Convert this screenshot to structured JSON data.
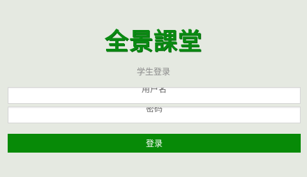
{
  "brand": {
    "logo_text": "全景課堂"
  },
  "form": {
    "subtitle": "学生登录",
    "username_placeholder": "用户名",
    "password_placeholder": "密码",
    "submit_label": "登录"
  },
  "colors": {
    "background": "#e5e9e1",
    "brand_green": "#0a8a12",
    "button_green": "#078a07"
  }
}
